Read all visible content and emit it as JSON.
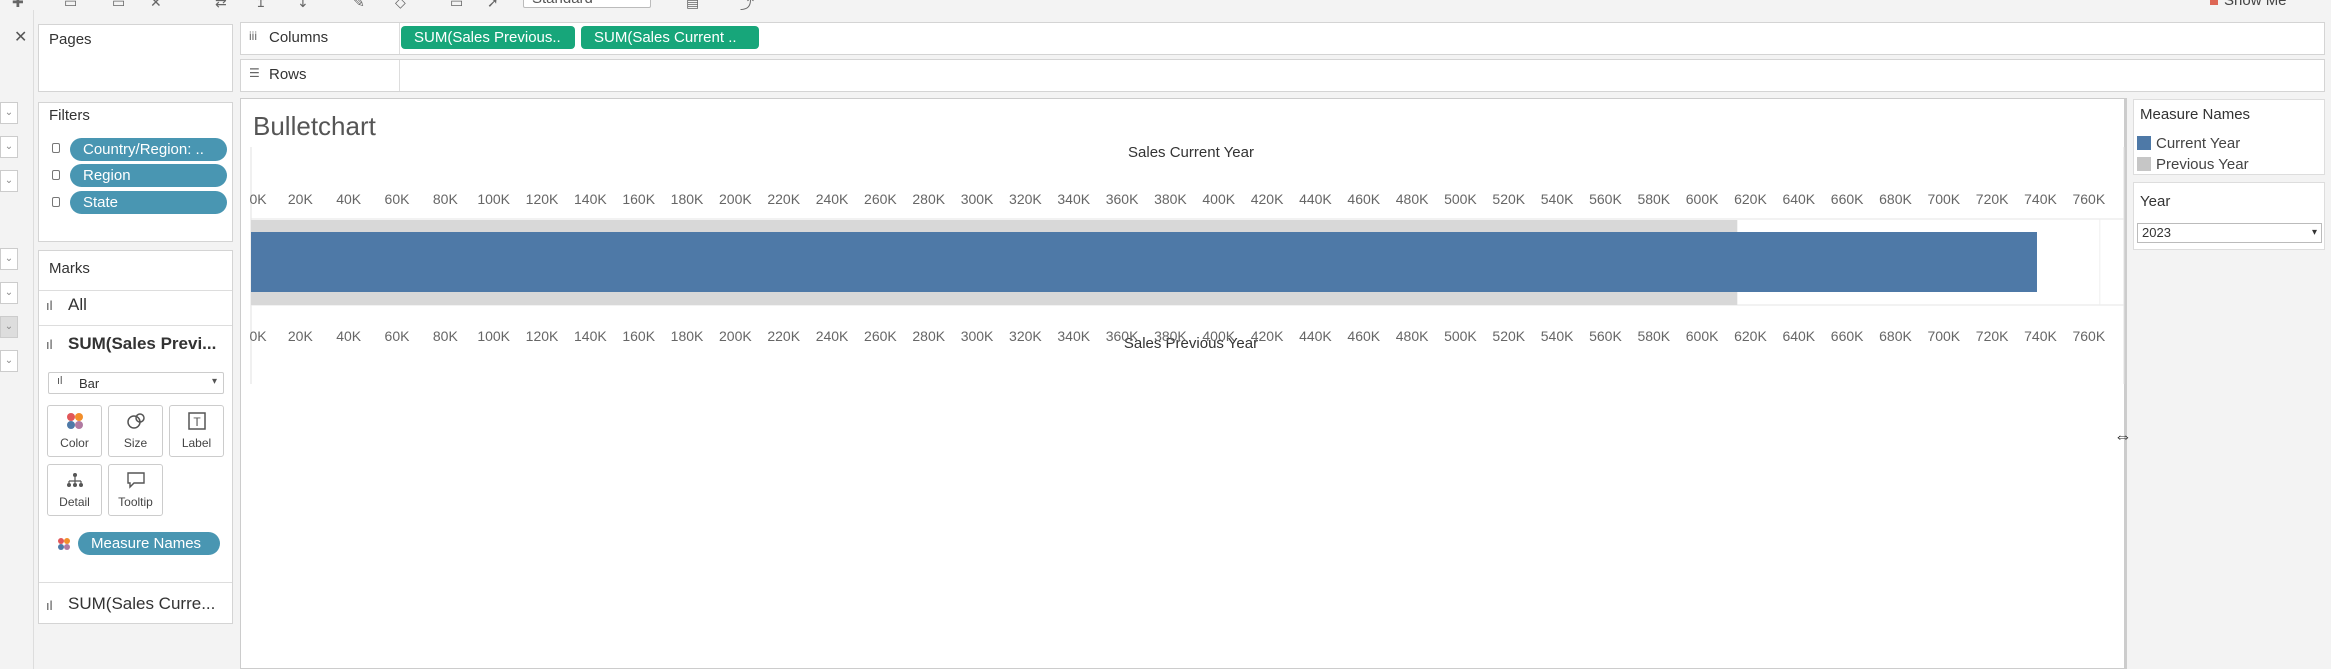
{
  "toolbar": {
    "view_size": "Standard",
    "show_me": "Show Me"
  },
  "pages": {
    "title": "Pages"
  },
  "filters": {
    "title": "Filters",
    "items": [
      "Country/Region: ..",
      "Region",
      "State"
    ]
  },
  "marks": {
    "title": "Marks",
    "rows": [
      "All",
      "SUM(Sales Previ...",
      "SUM(Sales Curre..."
    ],
    "mark_type": "Bar",
    "buttons": [
      "Color",
      "Size",
      "Label",
      "Detail",
      "Tooltip"
    ],
    "color_pill": "Measure Names"
  },
  "shelves": {
    "columns_label": "Columns",
    "rows_label": "Rows",
    "column_pills": [
      "SUM(Sales Previous..",
      "SUM(Sales Current .."
    ]
  },
  "legend": {
    "title": "Measure Names",
    "items": [
      {
        "label": "Current Year",
        "color": "#4e79a7"
      },
      {
        "label": "Previous Year",
        "color": "#c6c6c6"
      }
    ]
  },
  "year_filter": {
    "title": "Year",
    "value": "2023"
  },
  "chart_data": {
    "type": "bar",
    "title": "Bulletchart",
    "top_axis_title": "Sales Current Year",
    "bottom_axis_title": "Sales Previous Year",
    "ticks": [
      "0K",
      "20K",
      "40K",
      "60K",
      "80K",
      "100K",
      "120K",
      "140K",
      "160K",
      "180K",
      "200K",
      "220K",
      "240K",
      "260K",
      "280K",
      "300K",
      "320K",
      "340K",
      "360K",
      "380K",
      "400K",
      "420K",
      "440K",
      "460K",
      "480K",
      "500K",
      "520K",
      "540K",
      "560K",
      "580K",
      "600K",
      "620K",
      "640K",
      "660K",
      "680K",
      "700K",
      "720K",
      "740K",
      "760K"
    ],
    "xlim": [
      0,
      770000
    ],
    "series": [
      {
        "name": "Previous Year",
        "value": 610000,
        "color": "#d8d8d8"
      },
      {
        "name": "Current Year",
        "value": 734000,
        "color": "#4e79a7"
      }
    ]
  }
}
